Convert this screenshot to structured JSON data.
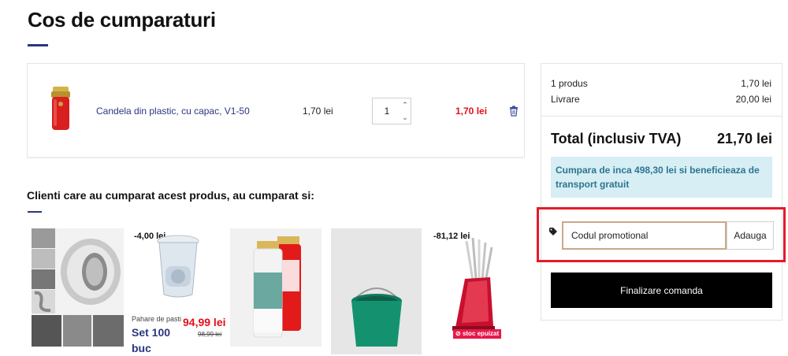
{
  "page": {
    "title": "Cos de cumparaturi"
  },
  "cart": {
    "items": [
      {
        "name": "Candela din plastic, cu capac, V1-50",
        "price": "1,70 lei",
        "quantity": "1",
        "total": "1,70 lei"
      }
    ]
  },
  "related": {
    "heading": "Clienti care au cumparat acest produs, au cumparat si:",
    "products": [
      {
        "image": "aluminium-tape-image"
      },
      {
        "image": "cups-image",
        "discount": "-4,00 lei",
        "label": "Pahare de pasti",
        "name": "Set 100 buc",
        "price": "94,99 lei",
        "old_price": "98,99 lei"
      },
      {
        "image": "candles-image"
      },
      {
        "image": "bucket-image"
      },
      {
        "image": "knife-set-image",
        "discount": "-81,12 lei",
        "badge": "stoc epuizat"
      }
    ]
  },
  "summary": {
    "products_label": "1 produs",
    "products_value": "1,70 lei",
    "delivery_label": "Livrare",
    "delivery_value": "20,00 lei",
    "total_label": "Total (inclusiv TVA)",
    "total_value": "21,70 lei",
    "free_shipping_info": "Cumpara de inca 498,30 lei si beneficieaza de transport gratuit",
    "promo_placeholder": "Codul promotional",
    "promo_button": "Adauga",
    "checkout_button": "Finalizare comanda"
  },
  "colors": {
    "accent": "#2c3580",
    "price_red": "#e3101a",
    "info_bg": "#d6eef4",
    "highlight": "#e21b2c"
  }
}
